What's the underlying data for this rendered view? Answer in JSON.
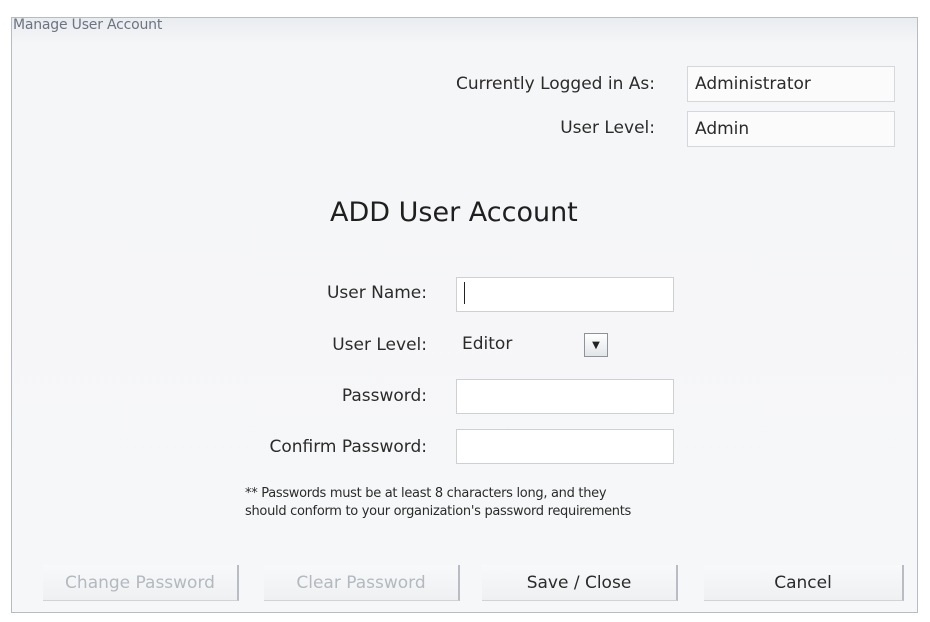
{
  "window": {
    "title": "Manage User Account"
  },
  "session": {
    "logged_in_label": "Currently Logged in As:",
    "logged_in_value": "Administrator",
    "level_label": "User Level:",
    "level_value": "Admin"
  },
  "form": {
    "heading": "ADD User Account",
    "username_label": "User Name:",
    "username_value": "",
    "userlevel_label": "User Level:",
    "userlevel_value": "Editor",
    "password_label": "Password:",
    "password_value": "",
    "confirm_label": "Confirm Password:",
    "confirm_value": "",
    "note_line1": "** Passwords must be at least 8 characters long, and they",
    "note_line2": "should conform to your organization's password requirements"
  },
  "buttons": {
    "change_password": "Change Password",
    "clear_password": "Clear Password",
    "save_close": "Save / Close",
    "cancel": "Cancel"
  }
}
